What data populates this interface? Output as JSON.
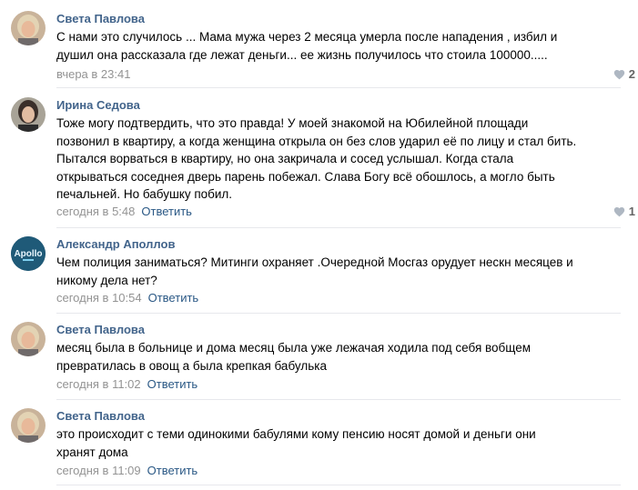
{
  "comments": [
    {
      "author": "Света Павлова",
      "text": "С нами это случилось ... Мама мужа через 2 месяца умерла после нападения , избил и\nдушил она рассказала где лежат деньги... ее жизнь получилось что стоила 100000.....",
      "date": "вчера в 23:41",
      "reply_label": "",
      "likes": "2",
      "avatar_icon": "woman-photo-icon"
    },
    {
      "author": "Ирина Седова",
      "text": "Тоже могу подтвердить, что это правда! У моей знакомой на Юбилейной площади\nпозвонил в квартиру, а когда женщина открыла он без слов ударил её по лицу и стал бить.\nПытался ворваться в квартиру, но она закричала и сосед услышал. Когда стала\nоткрываться соседнея дверь парень побежал. Слава Богу всё обошлось, а могло быть\nпечальней. Но бабушку побил.",
      "date": "сегодня в 5:48",
      "reply_label": "Ответить",
      "likes": "1",
      "avatar_icon": "woman-photo-icon"
    },
    {
      "author": "Александр Аполлов",
      "text": "Чем полиция заниматься? Митинги охраняет .Очередной Мосгаз орудует нескн месяцев и\nникому дела нет?",
      "date": "сегодня в 10:54",
      "reply_label": "Ответить",
      "likes": "",
      "avatar_icon": "apollo-logo-icon",
      "avatar_text": "Apollo"
    },
    {
      "author": "Света Павлова",
      "text": "месяц была в больнице и дома месяц была уже лежачая ходила под себя вобщем\nпревратилась в овощ а была крепкая бабулька",
      "date": "сегодня в 11:02",
      "reply_label": "Ответить",
      "likes": "",
      "avatar_icon": "woman-photo-icon"
    },
    {
      "author": "Света Павлова",
      "text": "это происходит с теми одинокими бабулями кому пенсию носят домой и деньги они\nхранят дома",
      "date": "сегодня в 11:09",
      "reply_label": "Ответить",
      "likes": "",
      "avatar_icon": "woman-photo-icon"
    }
  ],
  "colors": {
    "author": "#42648b",
    "link": "#2a5885",
    "meta": "#939393",
    "divider": "#e7e8ec"
  }
}
